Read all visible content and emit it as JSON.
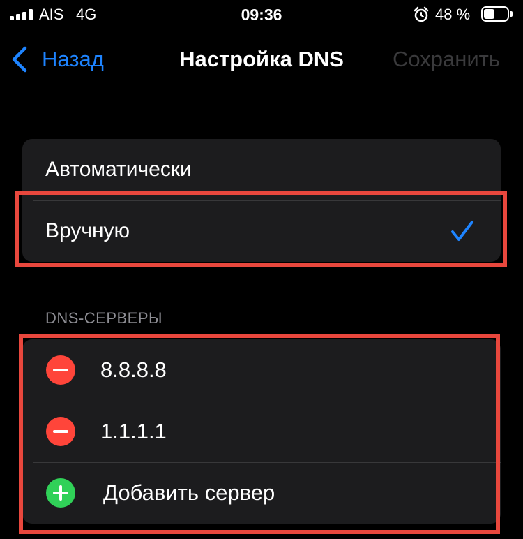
{
  "status_bar": {
    "carrier": "AIS",
    "network": "4G",
    "time": "09:36",
    "battery_percent_label": "48 %",
    "battery_level": 0.48,
    "icons": [
      "signal-icon",
      "alarm-icon",
      "battery-icon"
    ]
  },
  "nav": {
    "back_label": "Назад",
    "title": "Настройка DNS",
    "save_label": "Сохранить"
  },
  "mode": {
    "options": [
      {
        "label": "Автоматически",
        "selected": false
      },
      {
        "label": "Вручную",
        "selected": true
      }
    ]
  },
  "dns": {
    "header": "DNS-СЕРВЕРЫ",
    "servers": [
      "8.8.8.8",
      "1.1.1.1"
    ],
    "add_label": "Добавить сервер"
  },
  "colors": {
    "accent": "#1e84ff",
    "delete": "#ff453a",
    "add": "#30d158",
    "highlight": "#e8473d"
  }
}
